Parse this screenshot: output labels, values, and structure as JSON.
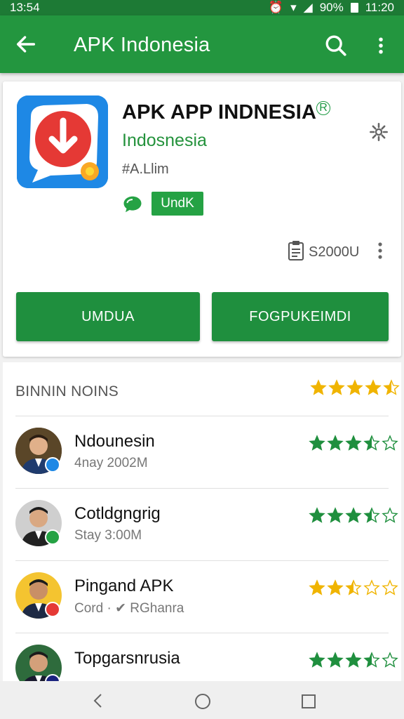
{
  "status_bar": {
    "time": "13:54",
    "battery": "90%",
    "clock": "11:20"
  },
  "app_bar": {
    "title": "APK Indonesia",
    "back_icon": "arrow-left-icon",
    "search_icon": "search-icon",
    "more_icon": "more-vert-icon",
    "color": "#23963f"
  },
  "app": {
    "title": "APK APP INDNESIA",
    "registered_mark": "R",
    "developer": "Indosnesia",
    "tag": "#A.Llim",
    "badge": "UndK",
    "size": "S2000U",
    "buttons": {
      "primary": "UMDUA",
      "secondary": "FOGPUKEIMDI"
    },
    "accent": "#1f8f3e"
  },
  "reviews": {
    "header": "BINNIN NOINS",
    "header_rating": 4.5,
    "items": [
      {
        "name": "Ndounesin",
        "sub": "4nay 2002M",
        "rating": 3.5,
        "star_color": "#1f8f3e",
        "badge_color": "#1e88e5"
      },
      {
        "name": "Cotldgngrig",
        "sub": "Stay 3:00M",
        "rating": 3.5,
        "star_color": "#1f8f3e",
        "badge_color": "#25a244"
      },
      {
        "name": "Pingand APK",
        "sub": "Cord · ✔ RGhanra",
        "rating": 2.5,
        "star_color": "#f0b400",
        "badge_color": "#e53935"
      },
      {
        "name": "Topgarsnrusia",
        "sub": "",
        "rating": 3.5,
        "star_color": "#1f8f3e",
        "badge_color": "#1a237e"
      }
    ]
  },
  "nav": {
    "back_icon": "nav-back-icon",
    "home_icon": "nav-home-icon",
    "recent_icon": "nav-recent-icon"
  }
}
